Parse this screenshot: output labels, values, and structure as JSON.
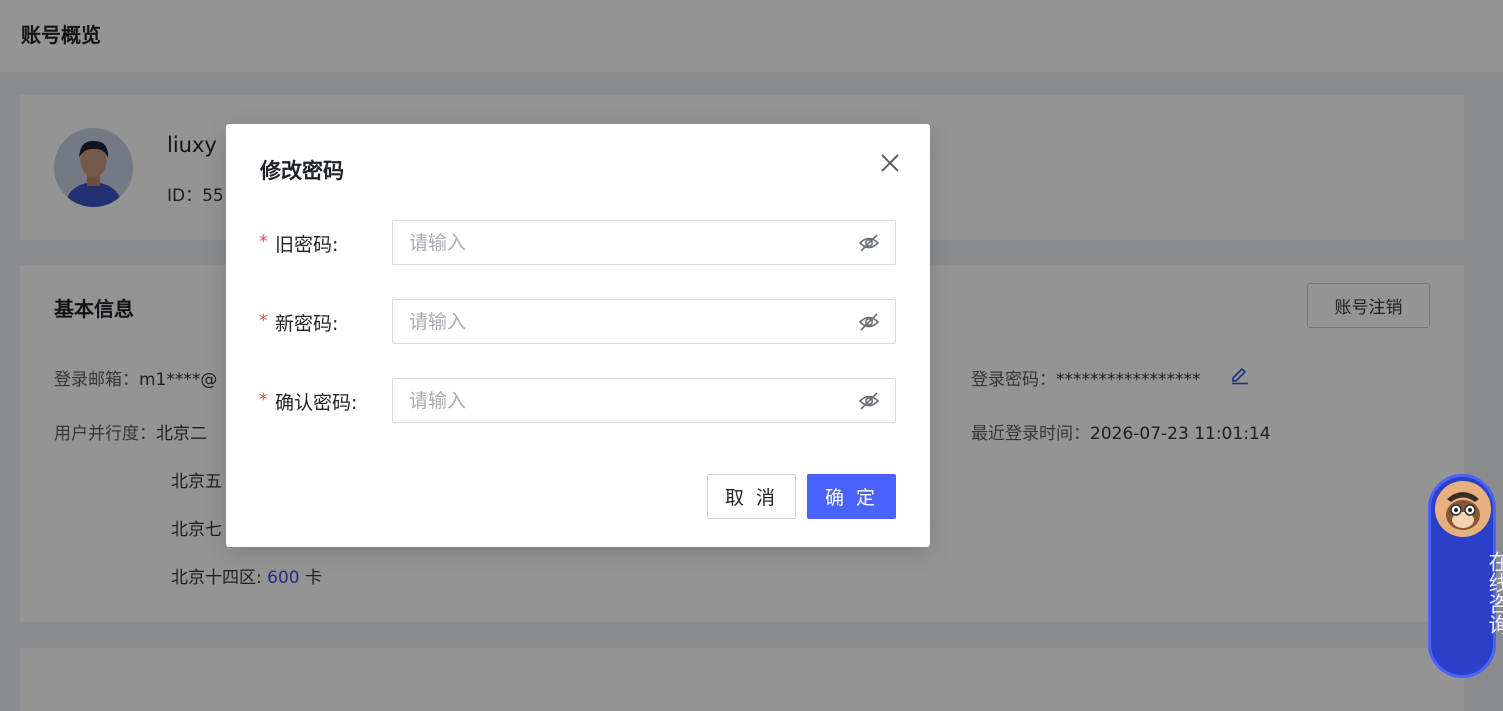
{
  "header": {
    "title": "账号概览"
  },
  "profile": {
    "username": "liuxy",
    "id_text": "ID：55"
  },
  "basic_info": {
    "title": "基本信息",
    "cancel_account_label": "账号注销",
    "email_label": "登录邮箱：",
    "email_value": "m1****@",
    "password_label": "登录密码：",
    "password_value": "*****************",
    "concurrency_label": "用户并行度：",
    "concurrency_lines": [
      "北京二",
      "北京五",
      "北京七"
    ],
    "concurrency_last": {
      "region": "北京十四区: ",
      "count": "600",
      "unit": " 卡"
    },
    "last_login_label": "最近登录时间：",
    "last_login_value": "2026-07-23 11:01:14"
  },
  "modal": {
    "title": "修改密码",
    "fields": [
      {
        "label": "旧密码:",
        "placeholder": "请输入"
      },
      {
        "label": "新密码:",
        "placeholder": "请输入"
      },
      {
        "label": "确认密码:",
        "placeholder": "请输入"
      }
    ],
    "required_mark": "*",
    "cancel_label": "取 消",
    "confirm_label": "确 定"
  },
  "consult": {
    "label": "在线咨询"
  },
  "colors": {
    "primary": "#4a62ff",
    "required": "#e5484d",
    "highlight": "#3355dd"
  },
  "icons": [
    "close-icon",
    "eye-off-icon",
    "edit-icon",
    "avatar",
    "consult-avatar"
  ]
}
